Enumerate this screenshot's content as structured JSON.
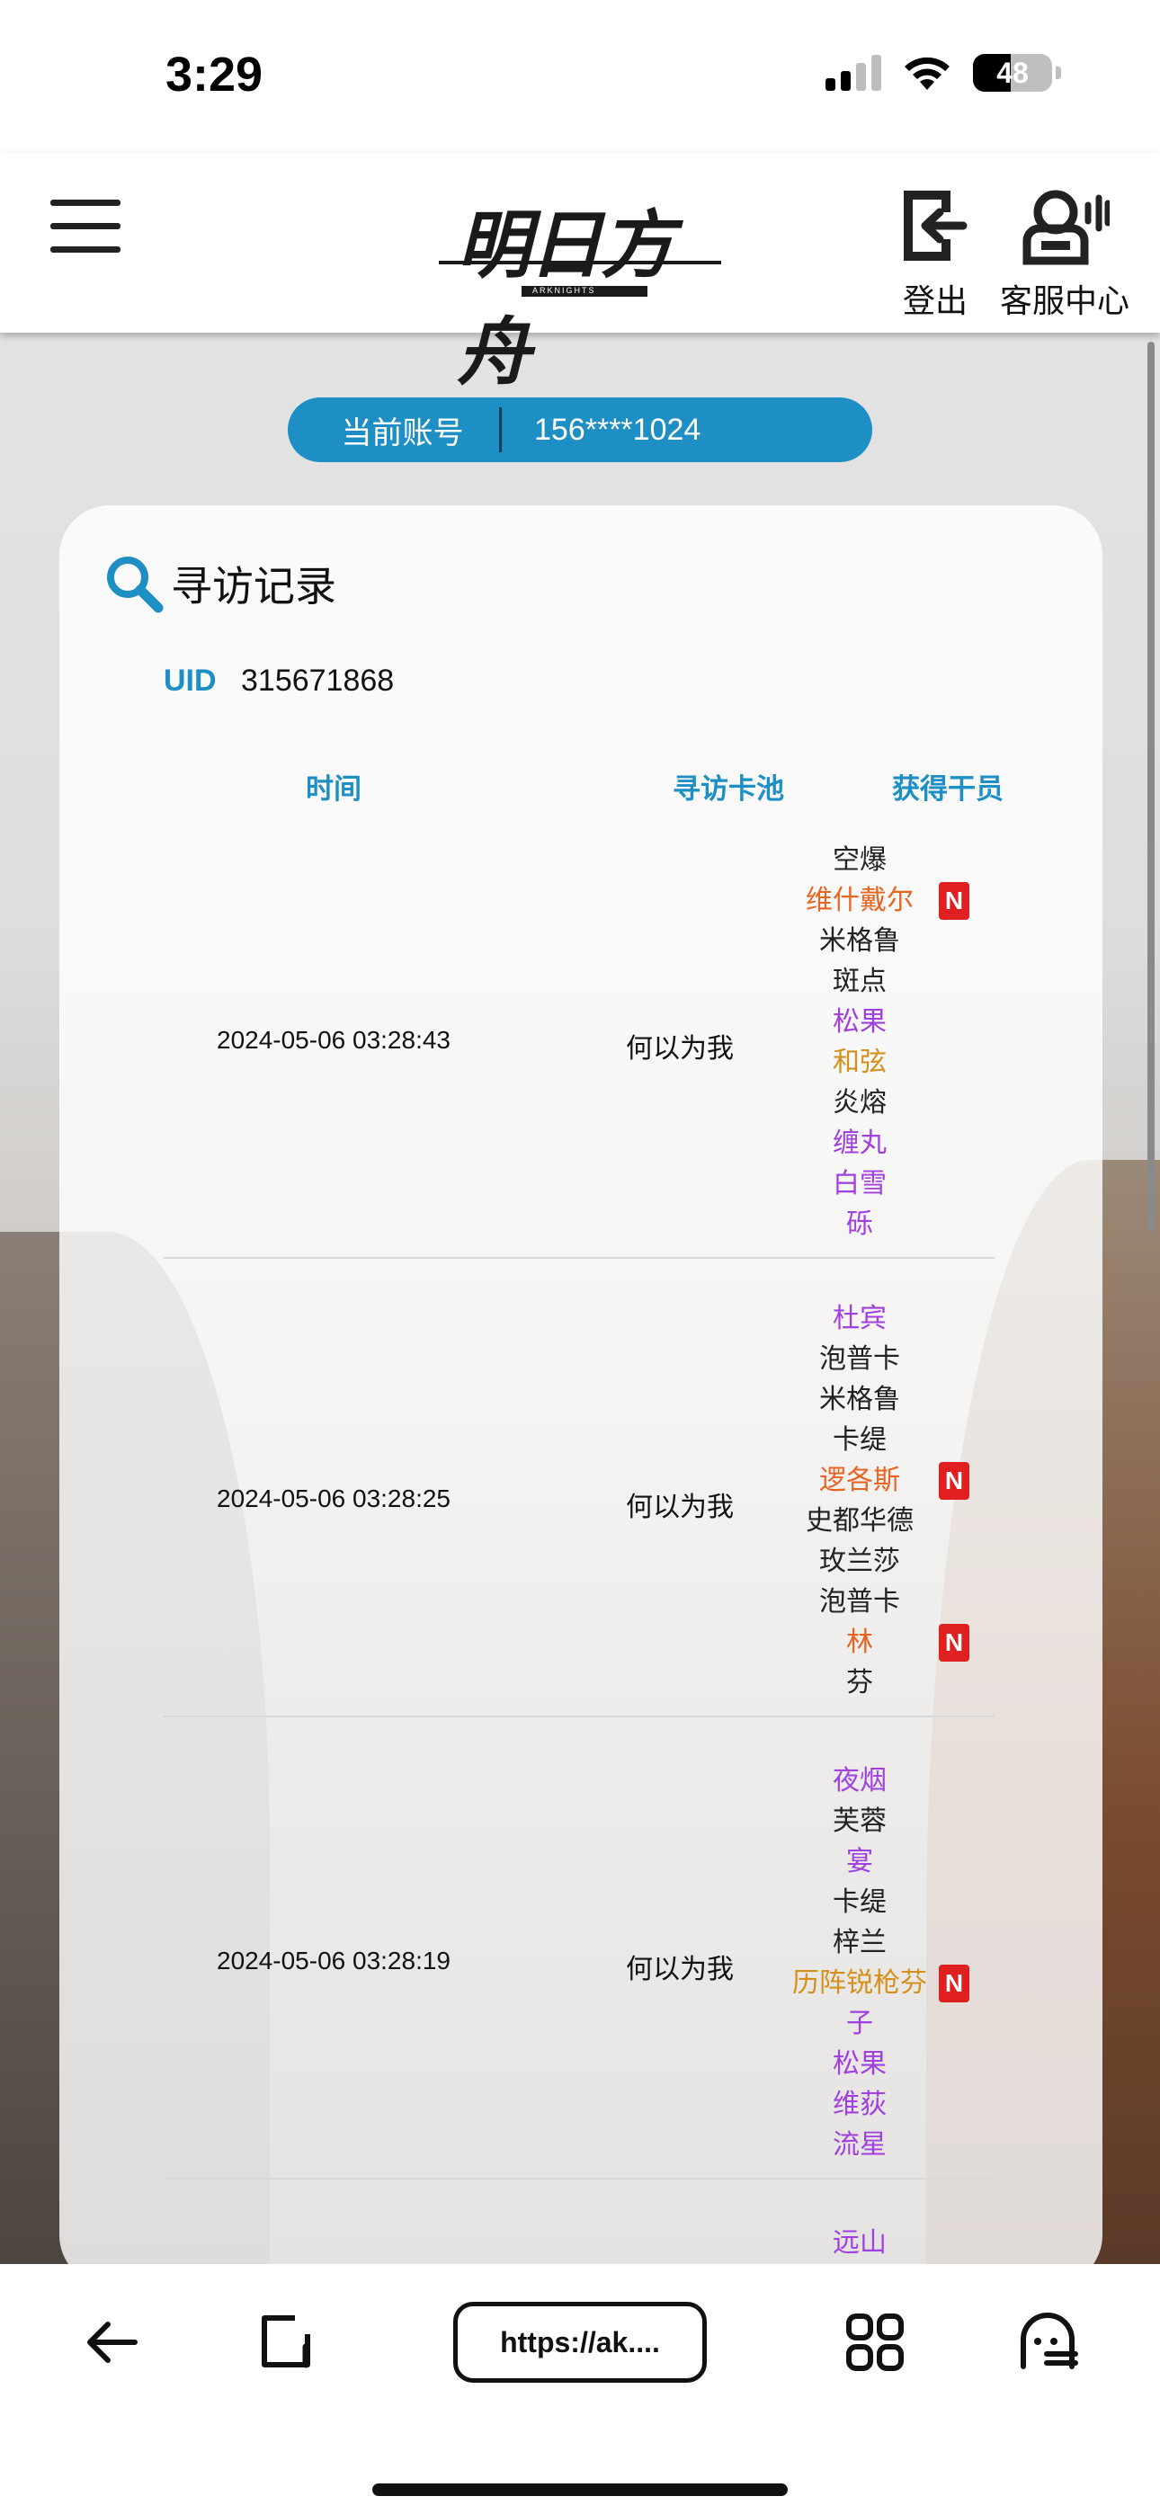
{
  "status_bar": {
    "time": "3:29",
    "battery": "48"
  },
  "header": {
    "logo_text": "明日方舟",
    "logo_sub": "ARKNIGHTS",
    "logout_label": "登出",
    "support_label": "客服中心"
  },
  "account": {
    "label": "当前账号",
    "value": "156****1024"
  },
  "card": {
    "title": "寻访记录",
    "uid_label": "UID",
    "uid_value": "315671868",
    "columns": {
      "time": "时间",
      "pool": "寻访卡池",
      "operator": "获得干员"
    }
  },
  "records": [
    {
      "time": "2024-05-06 03:28:43",
      "pool": "何以为我",
      "operators": [
        {
          "name": "空爆",
          "rarity": 3
        },
        {
          "name": "维什戴尔",
          "rarity": 6,
          "new": "N"
        },
        {
          "name": "米格鲁",
          "rarity": 3
        },
        {
          "name": "斑点",
          "rarity": 3
        },
        {
          "name": "松果",
          "rarity": 4
        },
        {
          "name": "和弦",
          "rarity": 5
        },
        {
          "name": "炎熔",
          "rarity": 3
        },
        {
          "name": "缠丸",
          "rarity": 4
        },
        {
          "name": "白雪",
          "rarity": 4
        },
        {
          "name": "砾",
          "rarity": 4
        }
      ]
    },
    {
      "time": "2024-05-06 03:28:25",
      "pool": "何以为我",
      "operators": [
        {
          "name": "杜宾",
          "rarity": 4
        },
        {
          "name": "泡普卡",
          "rarity": 3
        },
        {
          "name": "米格鲁",
          "rarity": 3
        },
        {
          "name": "卡缇",
          "rarity": 3
        },
        {
          "name": "逻各斯",
          "rarity": 6,
          "new": "N"
        },
        {
          "name": "史都华德",
          "rarity": 3
        },
        {
          "name": "玫兰莎",
          "rarity": 3
        },
        {
          "name": "泡普卡",
          "rarity": 3
        },
        {
          "name": "林",
          "rarity": 6,
          "new": "N"
        },
        {
          "name": "芬",
          "rarity": 3
        }
      ]
    },
    {
      "time": "2024-05-06 03:28:19",
      "pool": "何以为我",
      "operators": [
        {
          "name": "夜烟",
          "rarity": 4
        },
        {
          "name": "芙蓉",
          "rarity": 3
        },
        {
          "name": "宴",
          "rarity": 4
        },
        {
          "name": "卡缇",
          "rarity": 3
        },
        {
          "name": "梓兰",
          "rarity": 3
        },
        {
          "name": "历阵锐枪芬",
          "rarity": 5,
          "new": "N"
        },
        {
          "name": "子",
          "rarity": 4
        },
        {
          "name": "松果",
          "rarity": 4
        },
        {
          "name": "维荻",
          "rarity": 4
        },
        {
          "name": "流星",
          "rarity": 4
        }
      ]
    },
    {
      "time": "",
      "pool": "",
      "operators": [
        {
          "name": "远山",
          "rarity": 4
        }
      ]
    }
  ],
  "browser": {
    "url": "https://ak...."
  },
  "icons": {
    "menu": "hamburger-menu-icon",
    "logout": "logout-icon",
    "support": "headset-support-icon",
    "search": "search-icon",
    "back": "back-arrow-icon",
    "tabs": "tab-switch-icon",
    "apps": "grid-icon",
    "ghost": "ghost-icon"
  },
  "colors": {
    "accent": "#1e8fc4",
    "rarity3": "#222222",
    "rarity4": "#a040e0",
    "rarity5": "#d4901a",
    "rarity6": "#e86420",
    "new_badge": "#e02020"
  }
}
